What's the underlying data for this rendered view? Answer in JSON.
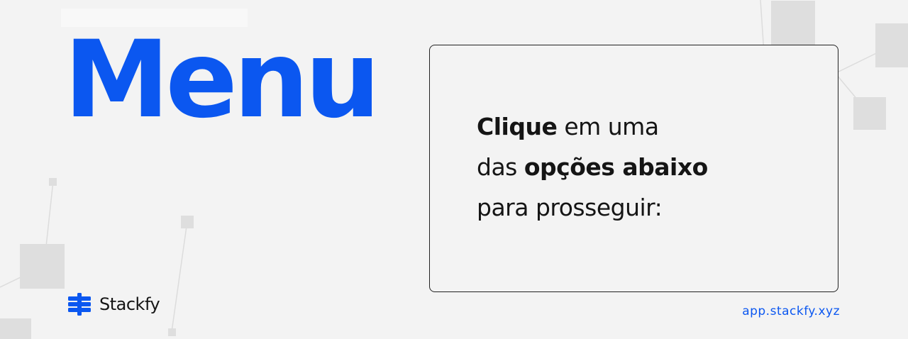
{
  "header": {
    "title": "Menu"
  },
  "card": {
    "line1_bold": "Clique",
    "line1_rest": " em uma",
    "line2_start": "das ",
    "line2_bold": "opções abaixo",
    "line3": "para prosseguir:"
  },
  "brand": {
    "name": "Stackfy",
    "url": "app.stackfy.xyz",
    "icon": "stackfy-logo-icon"
  },
  "colors": {
    "accent": "#0b57f0",
    "background": "#f3f3f3",
    "text": "#151515"
  }
}
